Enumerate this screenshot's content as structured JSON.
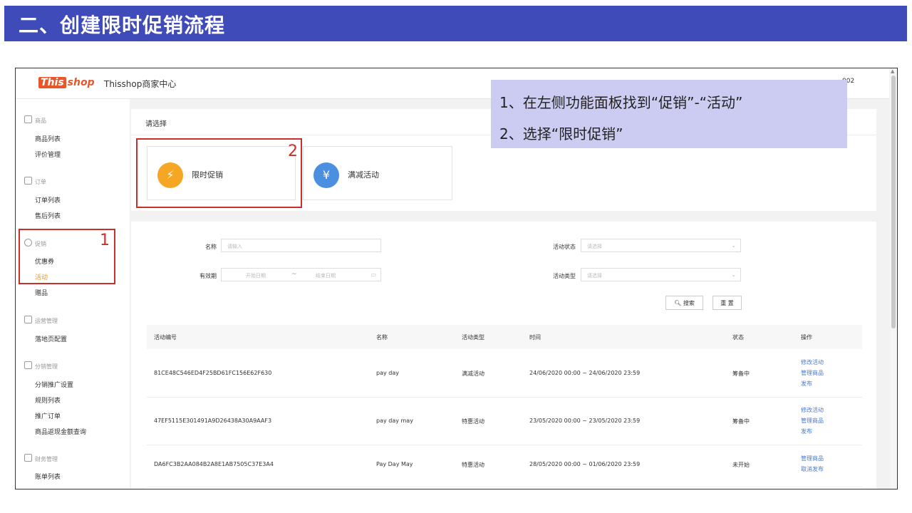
{
  "banner": {
    "title": "二、创建限时促销流程"
  },
  "app": {
    "logo_part1": "This",
    "logo_part2": "shop",
    "title": "Thisshop商家中心",
    "user_partial": "002"
  },
  "sidebar": {
    "groups": [
      {
        "label": "商品",
        "items": [
          "商品列表",
          "评价管理"
        ]
      },
      {
        "label": "订单",
        "items": [
          "订单列表",
          "售后列表"
        ]
      },
      {
        "label": "促销",
        "items": [
          "优惠券",
          "活动",
          "赠品"
        ]
      },
      {
        "label": "运营管理",
        "items": [
          "落地页配置"
        ]
      },
      {
        "label": "分销管理",
        "items": [
          "分销推广设置",
          "规则列表",
          "推广订单",
          "商品返现金额查询"
        ]
      },
      {
        "label": "财务管理",
        "items": [
          "账单列表"
        ]
      }
    ],
    "active_item": "活动"
  },
  "select_card": {
    "title": "请选择",
    "options": [
      {
        "label": "限时促销",
        "icon": "lightning-icon",
        "color": "#f5a623"
      },
      {
        "label": "满减活动",
        "icon": "coupon-yen-icon",
        "color": "#4a8fe0"
      }
    ]
  },
  "filters": {
    "name_label": "名称",
    "name_placeholder": "请输入",
    "status_label": "活动状态",
    "status_placeholder": "请选择",
    "validity_label": "有效期",
    "start_placeholder": "开始日期",
    "date_separator": "~",
    "end_placeholder": "结束日期",
    "type_label": "活动类型",
    "type_placeholder": "请选择",
    "search_button": "搜索",
    "reset_button": "重 置"
  },
  "table": {
    "headers": [
      "活动编号",
      "名称",
      "活动类型",
      "时间",
      "状态",
      "操作"
    ],
    "rows": [
      {
        "id": "81CE48C546ED4F25BD61FC156E62F630",
        "name": "pay day",
        "type": "满减活动",
        "time": "24/06/2020 00:00 ~ 24/06/2020 23:59",
        "status": "筹备中",
        "actions": [
          "修改活动",
          "管理商品",
          "发布"
        ]
      },
      {
        "id": "47EF5115E301491A9D26438A30A9AAF3",
        "name": "pay day may",
        "type": "特惠活动",
        "time": "23/05/2020 00:00 ~ 23/05/2020 23:59",
        "status": "筹备中",
        "actions": [
          "修改活动",
          "管理商品",
          "发布"
        ]
      },
      {
        "id": "DA6FC3B2AA084B2A8E1AB7505C37E3A4",
        "name": "Pay Day May",
        "type": "特惠活动",
        "time": "28/05/2020 00:00 ~ 01/06/2020 23:59",
        "status": "未开始",
        "actions": [
          "管理商品",
          "取消发布"
        ]
      }
    ]
  },
  "annotations": {
    "box1_number": "1",
    "box2_number": "2",
    "callout_line1": "1、在左侧功能面板找到“促销”-“活动”",
    "callout_line2": "2、选择“限时促销”"
  },
  "colors": {
    "banner": "#3f4bb8",
    "accent_orange": "#f5a623",
    "link_blue": "#4a78d4",
    "annotation_red": "#c9302c",
    "callout_bg": "#ccccf2"
  }
}
